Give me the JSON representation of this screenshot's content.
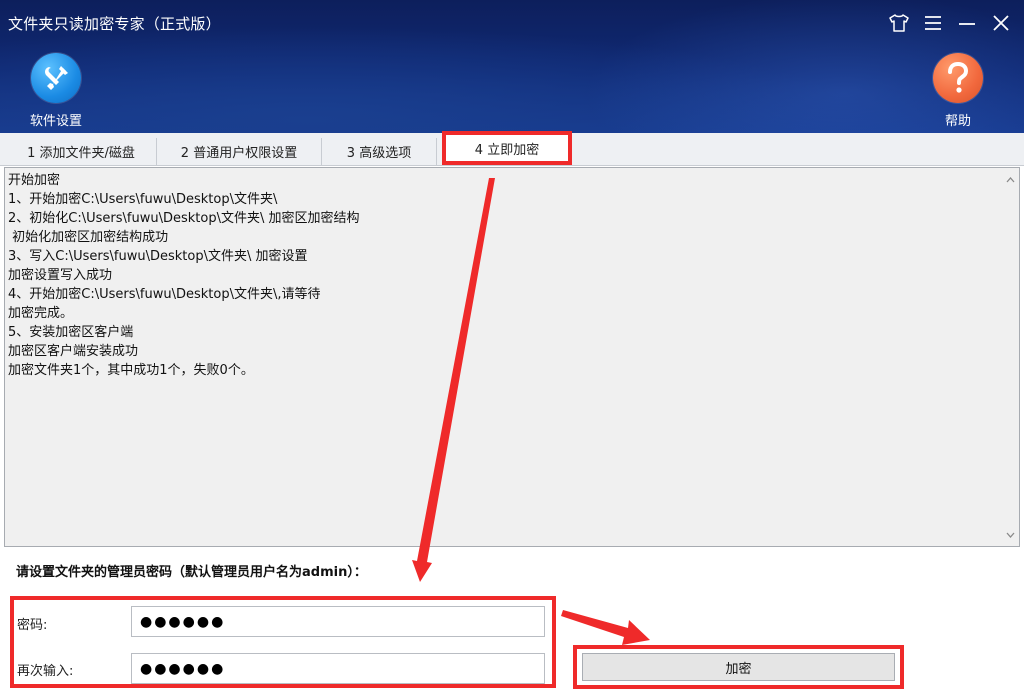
{
  "window": {
    "title": "文件夹只读加密专家（正式版）",
    "controls": [
      {
        "name": "skin-icon"
      },
      {
        "name": "menu-icon"
      },
      {
        "name": "minimize-icon"
      },
      {
        "name": "close-icon"
      }
    ]
  },
  "toolbar": {
    "settings_label": "软件设置",
    "help_label": "帮助"
  },
  "tabs": [
    {
      "label": "1 添加文件夹/磁盘"
    },
    {
      "label": "2 普通用户权限设置"
    },
    {
      "label": "3 高级选项"
    },
    {
      "label": "4 立即加密",
      "active": true
    }
  ],
  "log": {
    "lines": [
      "开始加密",
      "1、开始加密C:\\Users\\fuwu\\Desktop\\文件夹\\",
      "2、初始化C:\\Users\\fuwu\\Desktop\\文件夹\\ 加密区加密结构",
      " 初始化加密区加密结构成功",
      "3、写入C:\\Users\\fuwu\\Desktop\\文件夹\\ 加密设置",
      "加密设置写入成功",
      "4、开始加密C:\\Users\\fuwu\\Desktop\\文件夹\\,请等待",
      "加密完成。",
      "5、安装加密区客户端",
      "加密区客户端安装成功",
      "加密文件夹1个，其中成功1个，失败0个。"
    ]
  },
  "form": {
    "prompt": "请设置文件夹的管理员密码（默认管理员用户名为admin）：",
    "password_label": "密码:",
    "password_value": "●●●●●●",
    "confirm_label": "再次输入:",
    "confirm_value": "●●●●●●",
    "encrypt_label": "加密"
  },
  "colors": {
    "annotation": "#ef2a2a",
    "header_dark": "#0d1f5c",
    "header_light": "#173a8f",
    "settings_icon": "#1b8be4",
    "help_icon": "#f1683d"
  }
}
